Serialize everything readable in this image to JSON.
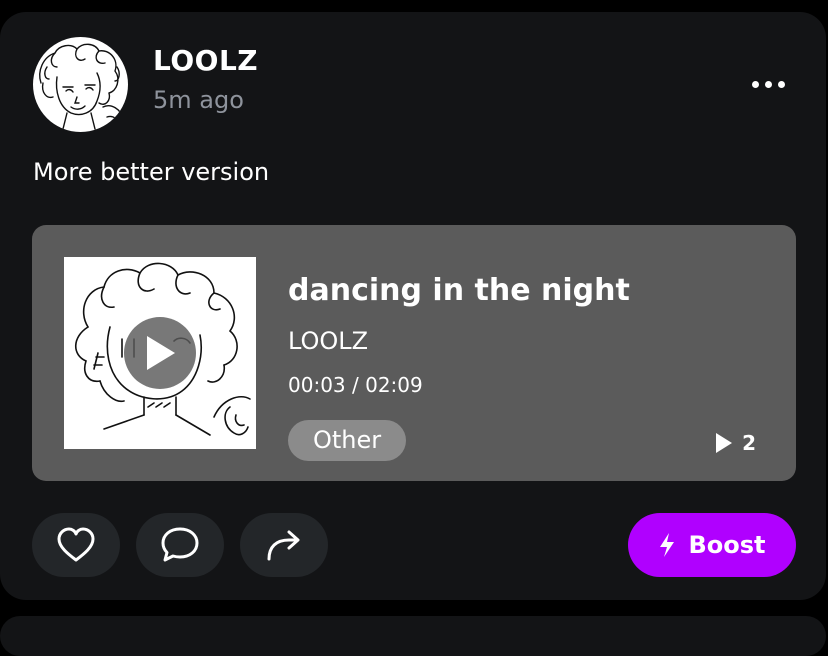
{
  "post": {
    "username": "LOOLZ",
    "time_ago": "5m ago",
    "caption": "More better version"
  },
  "track": {
    "title": "dancing in the night",
    "artist": "LOOLZ",
    "position": "00:03",
    "duration": "02:09",
    "time_display": "00:03 / 02:09",
    "genre": "Other",
    "play_count": "2"
  },
  "actions": {
    "boost_label": "Boost"
  },
  "icons": {
    "menu": "more-dots-icon",
    "play": "play-icon",
    "plays": "play-count-icon",
    "like": "heart-icon",
    "comment": "comment-icon",
    "share": "share-icon",
    "boost": "lightning-icon"
  },
  "colors": {
    "background": "#000000",
    "card": "#131416",
    "media_panel": "#5b5b5b",
    "tag": "#8b8b8b",
    "action_button": "#232629",
    "boost": "#b000ff",
    "secondary_text": "#8e939c"
  }
}
